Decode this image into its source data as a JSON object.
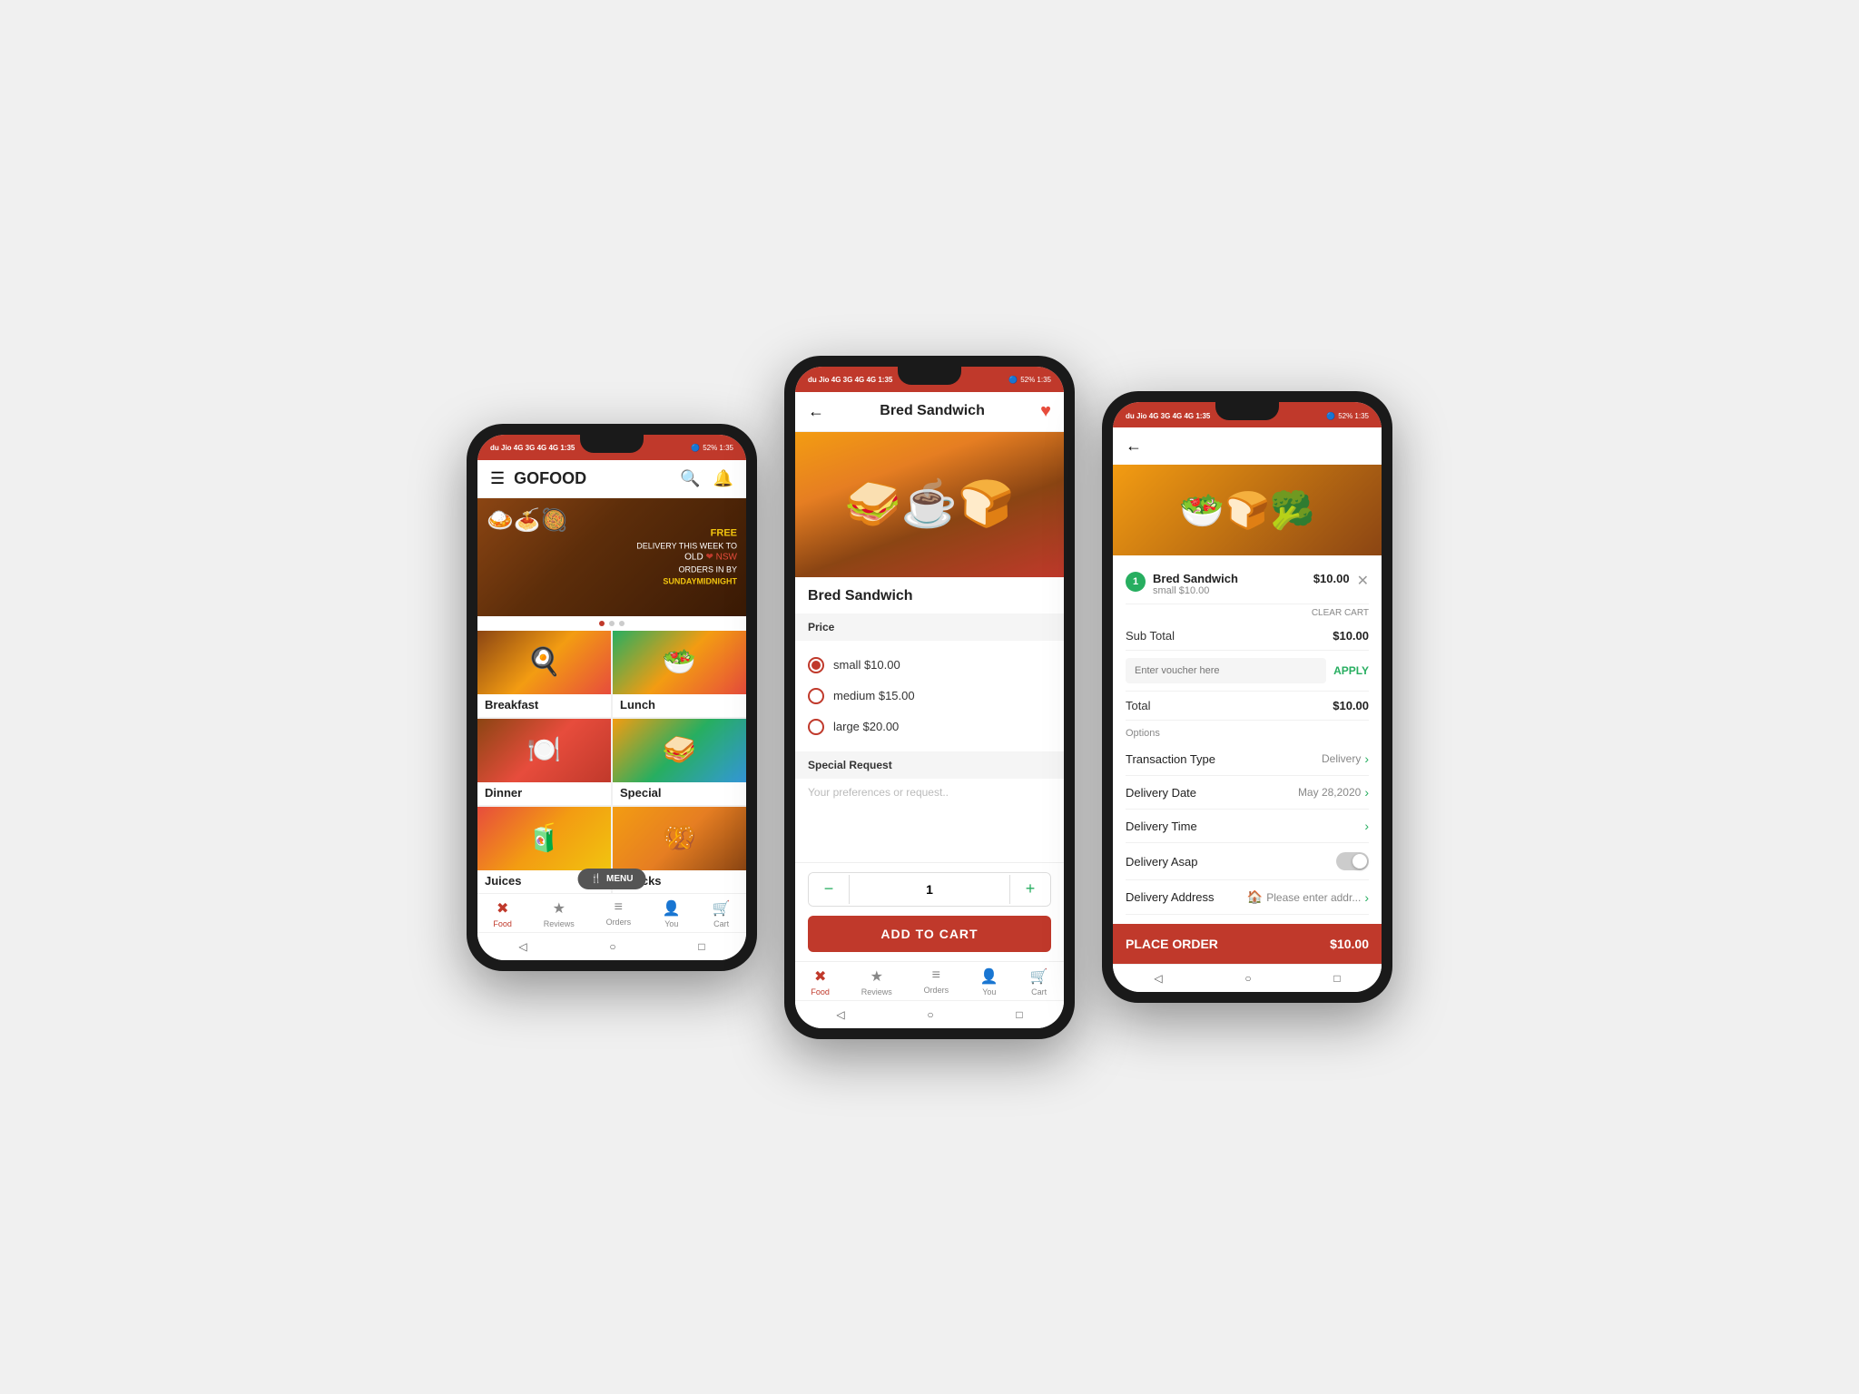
{
  "phone1": {
    "status": {
      "left": "du  Jio 4G  3G  4G  4G  1:35",
      "right": "52% 1:35"
    },
    "header": {
      "title": "GOFOOD",
      "search_icon": "🔍",
      "bell_icon": "🔔"
    },
    "banner": {
      "free_text": "FREE",
      "delivery_text": "DELIVERY THIS WEEK TO",
      "state_text": "OLD ❤ NSW",
      "orders_text": "ORDERS IN BY",
      "deadline": "SUNDAYMIDNIGHT"
    },
    "categories": [
      {
        "label": "Breakfast",
        "emoji": "🍳",
        "class": "food-breakfast"
      },
      {
        "label": "Lunch",
        "emoji": "🥗",
        "class": "food-lunch"
      },
      {
        "label": "Dinner",
        "emoji": "🍽️",
        "class": "food-dinner"
      },
      {
        "label": "Special",
        "emoji": "🥪",
        "class": "food-special"
      },
      {
        "label": "Juices",
        "emoji": "🧃",
        "class": "food-juices"
      },
      {
        "label": "Snacks",
        "emoji": "🥨",
        "class": "food-snacks"
      }
    ],
    "menu_fab": "MENU",
    "bottom_nav": [
      {
        "label": "Food",
        "icon": "✖",
        "active": true
      },
      {
        "label": "Reviews",
        "icon": "★",
        "active": false
      },
      {
        "label": "Orders",
        "icon": "≡",
        "active": false
      },
      {
        "label": "You",
        "icon": "👤",
        "active": false
      },
      {
        "label": "Cart",
        "icon": "🛒",
        "active": false
      }
    ]
  },
  "phone2": {
    "status": {
      "left": "du  Jio 4G  3G  4G  4G  1:35",
      "right": "52% 1:35"
    },
    "header": {
      "title": "Bred Sandwich",
      "back_icon": "←",
      "heart_icon": "♥"
    },
    "product": {
      "name": "Bred Sandwich",
      "price_label": "Price",
      "options": [
        {
          "label": "small",
          "price": "$10.00",
          "selected": true
        },
        {
          "label": "medium",
          "price": "$15.00",
          "selected": false
        },
        {
          "label": "large",
          "price": "$20.00",
          "selected": false
        }
      ],
      "special_request_label": "Special Request",
      "special_request_placeholder": "Your preferences or request.."
    },
    "quantity": 1,
    "minus_label": "−",
    "plus_label": "+",
    "add_cart_label": "ADD TO CART"
  },
  "phone3": {
    "status": {
      "left": "du  Jio 4G  3G  4G  4G  1:35",
      "right": "52% 1:35"
    },
    "header": {
      "back_icon": "←"
    },
    "cart_item": {
      "quantity": 1,
      "name": "Bred Sandwich",
      "variant": "small $10.00",
      "price": "$10.00"
    },
    "clear_cart_label": "CLEAR CART",
    "sub_total_label": "Sub Total",
    "sub_total_value": "$10.00",
    "voucher_placeholder": "Enter voucher here",
    "apply_label": "APPLY",
    "total_label": "Total",
    "total_value": "$10.00",
    "options_label": "Options",
    "transaction_type_label": "Transaction Type",
    "transaction_type_value": "Delivery",
    "delivery_date_label": "Delivery Date",
    "delivery_date_value": "May 28,2020",
    "delivery_time_label": "Delivery Time",
    "delivery_asap_label": "Delivery Asap",
    "delivery_address_label": "Delivery Address",
    "delivery_address_value": "Please enter addr...",
    "place_order_label": "PLACE ORDER",
    "place_order_price": "$10.00"
  }
}
